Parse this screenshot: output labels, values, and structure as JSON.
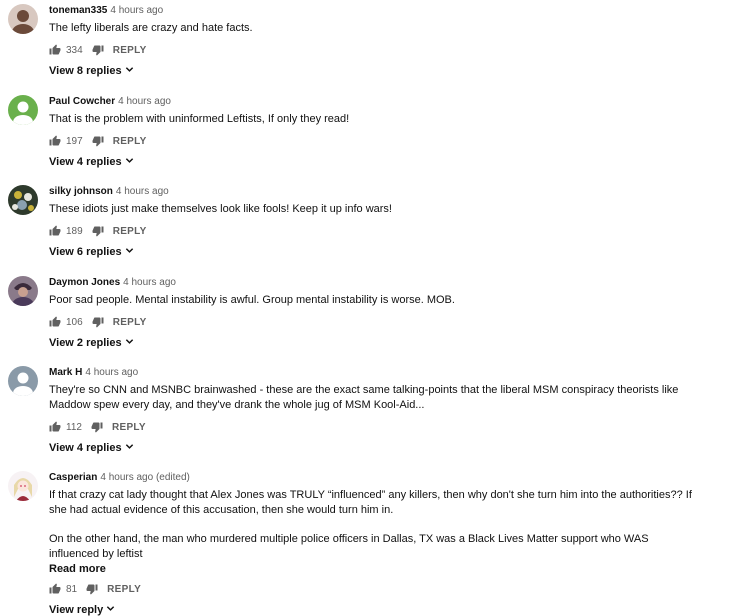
{
  "comments": [
    {
      "author": "toneman335",
      "time": "4 hours ago",
      "text": "The lefty liberals are crazy and hate facts.",
      "likes": "334",
      "reply": "REPLY",
      "view_replies": "View 8 replies",
      "avatar_color": "#6b4a3a"
    },
    {
      "author": "Paul Cowcher",
      "time": "4 hours ago",
      "text": "That is the problem with uninformed Leftists, If only they read!",
      "likes": "197",
      "reply": "REPLY",
      "view_replies": "View 4 replies",
      "avatar_color": "#6ab04c"
    },
    {
      "author": "silky johnson",
      "time": "4 hours ago",
      "text": "These idiots just make themselves look like fools! Keep it up info wars!",
      "likes": "189",
      "reply": "REPLY",
      "view_replies": "View 6 replies",
      "avatar_color": "#3d4a3a"
    },
    {
      "author": "Daymon Jones",
      "time": "4 hours ago",
      "text": "Poor sad people. Mental instability is awful. Group mental instability is worse. MOB.",
      "likes": "106",
      "reply": "REPLY",
      "view_replies": "View 2 replies",
      "avatar_color": "#5a4a5a"
    },
    {
      "author": "Mark H",
      "time": "4 hours ago",
      "text": "They're so CNN and MSNBC brainwashed - these are the exact same talking-points that the liberal MSM conspiracy theorists like Maddow spew every day, and they've drank the whole jug of MSM Kool-Aid...",
      "likes": "112",
      "reply": "REPLY",
      "view_replies": "View 4 replies",
      "avatar_color": "#8a9aa8"
    },
    {
      "author": "Casperian",
      "time": "4 hours ago (edited)",
      "text": "If that crazy cat lady thought that Alex Jones was TRULY “influenced” any killers, then why don't she turn him into the authorities?? If she had actual evidence of this accusation, then she would turn him in.",
      "text2": "On the other hand, the man who murdered multiple police officers in Dallas, TX was a Black Lives Matter support who WAS influenced by leftist",
      "read_more": "Read more",
      "likes": "81",
      "reply": "REPLY",
      "view_replies": "View reply",
      "avatar_color": "#f2ecef"
    }
  ],
  "icons": {
    "like": "thumbs-up-icon",
    "dislike": "thumbs-down-icon",
    "expand": "chevron-down-icon"
  }
}
